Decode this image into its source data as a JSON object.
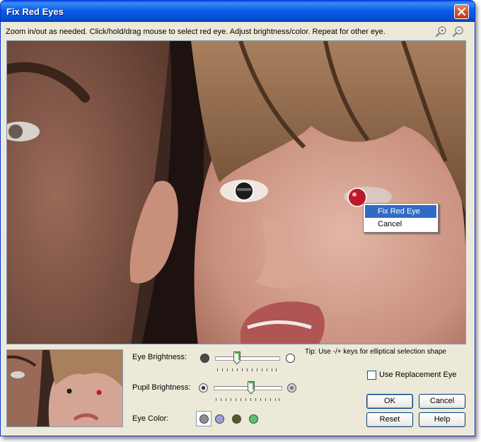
{
  "window": {
    "title": "Fix Red Eyes"
  },
  "instructions": "Zoom in/out as needed. Click/hold/drag mouse to select red eye. Adjust brightness/color. Repeat for other eye.",
  "context_menu": {
    "items": [
      "Fix Red Eye",
      "Cancel"
    ]
  },
  "tip": "Tip: Use -/+ keys for elliptical selection shape",
  "controls": {
    "eye_brightness_label": "Eye Brightness:",
    "eye_brightness_value": 0.33,
    "pupil_brightness_label": "Pupil Brightness:",
    "pupil_brightness_value": 0.55,
    "eye_color_label": "Eye Color:",
    "eye_colors": [
      "#909090",
      "#A29BD8",
      "#5A5530",
      "#58C46A"
    ],
    "selected_eye_color_index": 0
  },
  "checkbox": {
    "label": "Use Replacement Eye",
    "checked": false
  },
  "buttons": {
    "ok": "OK",
    "cancel": "Cancel",
    "reset": "Reset",
    "help": "Help"
  },
  "icons": [
    "close-icon",
    "zoom-in-icon",
    "zoom-out-icon"
  ]
}
